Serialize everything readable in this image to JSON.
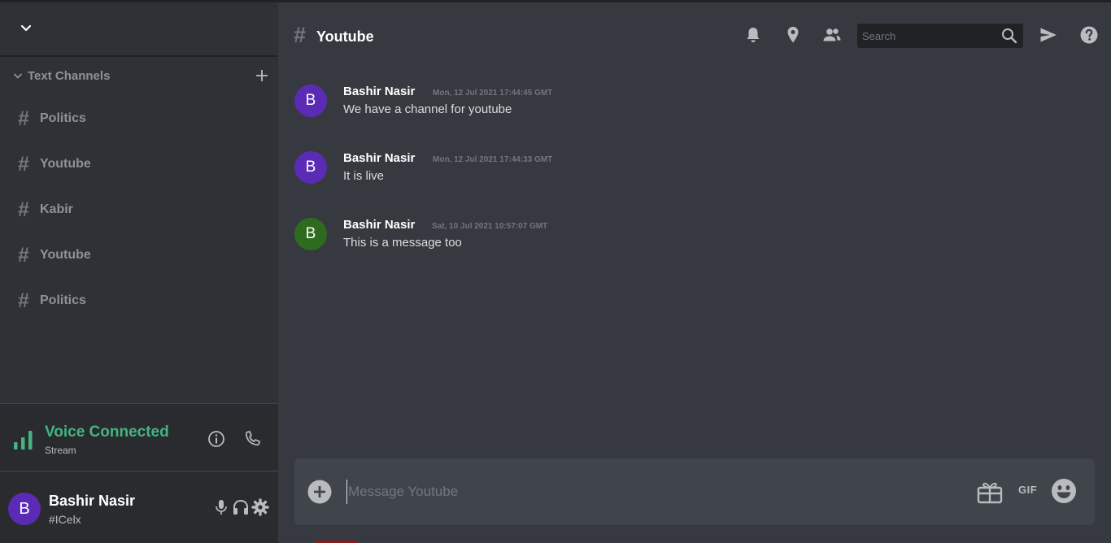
{
  "sidebar": {
    "category_label": "Text Channels",
    "channels": [
      {
        "hash": "#",
        "label": "Politics"
      },
      {
        "hash": "#",
        "label": "Youtube"
      },
      {
        "hash": "#",
        "label": "Kabir"
      },
      {
        "hash": "#",
        "label": "Youtube"
      },
      {
        "hash": "#",
        "label": "Politics"
      }
    ],
    "voice": {
      "title": "Voice Connected",
      "subtitle": "Stream"
    },
    "user": {
      "avatar_letter": "B",
      "name": "Bashir Nasir",
      "tag": "#ICelx"
    }
  },
  "header": {
    "hash": "#",
    "channel_title": "Youtube",
    "search_placeholder": "Search",
    "icons": [
      "bell-icon",
      "pin-icon",
      "members-icon",
      "search-icon",
      "send-icon",
      "help-icon"
    ]
  },
  "messages": [
    {
      "avatar_letter": "B",
      "avatar_color": "#5b2bb5",
      "author": "Bashir Nasir",
      "timestamp": "Mon, 12 Jul 2021 17:44:45 GMT",
      "text": "We have a channel for youtube"
    },
    {
      "avatar_letter": "B",
      "avatar_color": "#5b2bb5",
      "author": "Bashir Nasir",
      "timestamp": "Mon, 12 Jul 2021 17:44:33 GMT",
      "text": "It is live"
    },
    {
      "avatar_letter": "B",
      "avatar_color": "#2e6b1f",
      "author": "Bashir Nasir",
      "timestamp": "Sat, 10 Jul 2021 10:57:07 GMT",
      "text": "This is a message too"
    }
  ],
  "composer": {
    "placeholder": "Message Youtube",
    "gif_label": "GIF"
  },
  "colors": {
    "accent_green": "#43b581",
    "background": "#36393f",
    "sidebar": "#2f3136"
  }
}
